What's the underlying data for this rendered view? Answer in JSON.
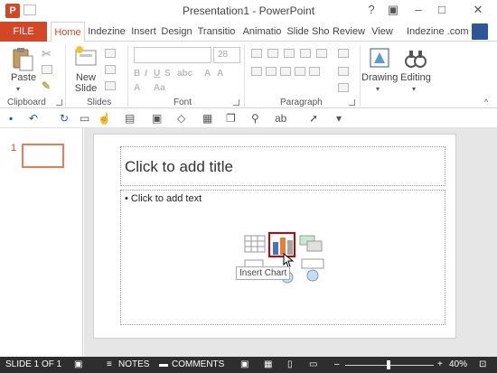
{
  "window": {
    "title": "Presentation1 - PowerPoint",
    "help_label": "?"
  },
  "tabs": {
    "file": "FILE",
    "items": [
      "Home",
      "Indezine",
      "Insert",
      "Design",
      "Transitio",
      "Animatio",
      "Slide Sho",
      "Review",
      "View"
    ],
    "active": "Home",
    "account": "Indezine .com"
  },
  "ribbon": {
    "paste_label": "Paste",
    "new_slide_label": "New Slide",
    "new_slide_line1": "New",
    "new_slide_line2": "Slide",
    "font_size": "28",
    "drawing_label": "Drawing",
    "editing_label": "Editing",
    "groups": [
      "Clipboard",
      "Slides",
      "Font",
      "Paragraph"
    ]
  },
  "thumbnails": {
    "slide_number": "1"
  },
  "slide": {
    "title_placeholder": "Click to add title",
    "body_placeholder": "• Click to add text",
    "tooltip": "Insert Chart"
  },
  "status": {
    "slide_info": "SLIDE 1 OF 1",
    "notes": "NOTES",
    "comments": "COMMENTS",
    "zoom": "40%"
  },
  "colors": {
    "accent": "#d24726",
    "status_bar": "#2e2e2e",
    "highlight": "#d00000"
  }
}
